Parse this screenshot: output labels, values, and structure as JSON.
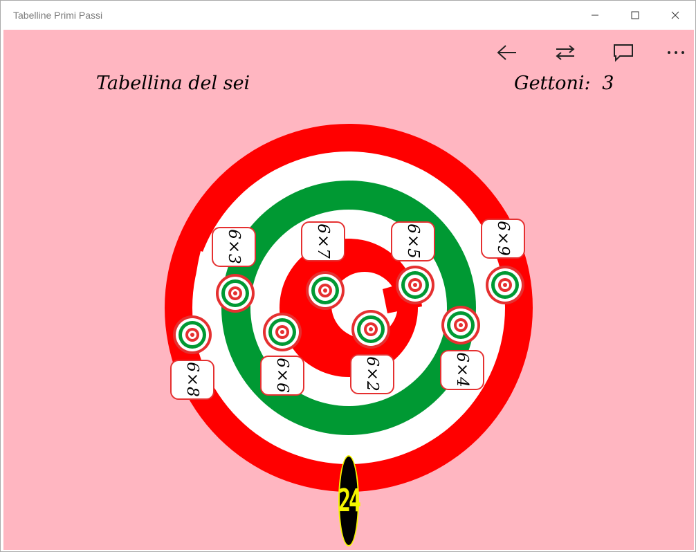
{
  "window": {
    "title": "Tabelline Primi Passi"
  },
  "appbar": {
    "icons": [
      "back-arrow-icon",
      "swap-arrows-icon",
      "comment-icon",
      "more-icon"
    ]
  },
  "header": {
    "title": "Tabellina del sei",
    "tokens_label": "Gettoni:",
    "tokens_value": "3"
  },
  "cards": [
    {
      "label": "6×3"
    },
    {
      "label": "6×7"
    },
    {
      "label": "6×5"
    },
    {
      "label": "6×9"
    },
    {
      "label": "6×8"
    },
    {
      "label": "6×6"
    },
    {
      "label": "6×2"
    },
    {
      "label": "6×4"
    }
  ],
  "score": {
    "value": "24"
  },
  "colors": {
    "background": "#ffb6c1",
    "red": "#ff0000",
    "green": "#009933",
    "white": "#ffffff",
    "score_bg": "#000000",
    "score_fg": "#f5f500"
  }
}
